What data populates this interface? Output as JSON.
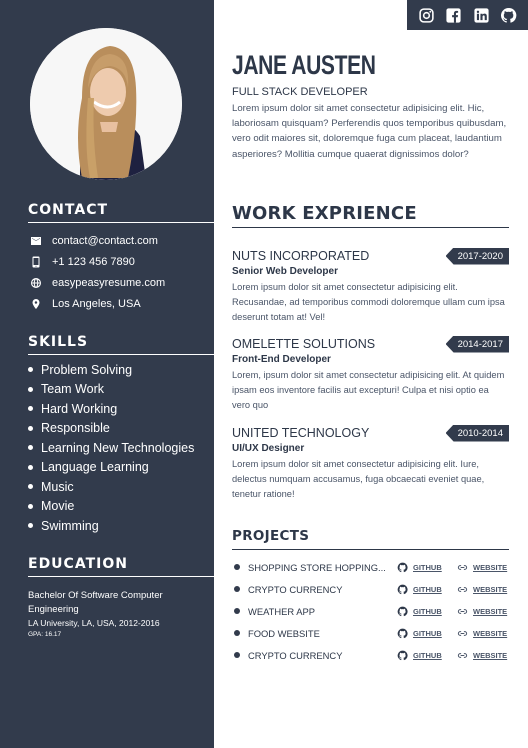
{
  "profile": {
    "name": "JANE AUSTEN",
    "role": "FULL STACK DEVELOPER",
    "bio": "Lorem ipsum dolor sit amet consectetur adipisicing elit. Hic, laboriosam quisquam? Perferendis quos temporibus quibusdam, vero odit maiores sit, doloremque fuga cum placeat, laudantium asperiores? Mollitia cumque quaerat dignissimos dolor?"
  },
  "social": [
    "instagram-icon",
    "facebook-icon",
    "linkedin-icon",
    "github-icon"
  ],
  "contact": {
    "heading": "CONTACT",
    "items": [
      {
        "icon": "mail-icon",
        "text": "contact@contact.com"
      },
      {
        "icon": "phone-icon",
        "text": "+1 123 456 7890"
      },
      {
        "icon": "globe-icon",
        "text": "easypeasyresume.com"
      },
      {
        "icon": "location-icon",
        "text": "Los Angeles, USA"
      }
    ]
  },
  "skills": {
    "heading": "SKILLS",
    "items": [
      "Problem Solving",
      "Team Work",
      "Hard Working",
      "Responsible",
      "Learning New Technologies",
      "Language Learning",
      "Music",
      "Movie",
      "Swimming"
    ]
  },
  "education": {
    "heading": "EDUCATION",
    "degree": "Bachelor Of Software Computer Engineering",
    "university": "LA University, LA, USA, 2012-2016",
    "gpa": "GPA: 16.17"
  },
  "work": {
    "heading": "WORK EXPRIENCE",
    "jobs": [
      {
        "company": "NUTS INCORPORATED",
        "years": "2017-2020",
        "title": "Senior Web Developer",
        "desc": "Lorem ipsum dolor sit amet consectetur adipisicing elit. Recusandae, ad temporibus commodi doloremque ullam cum ipsa deserunt totam at! Vel!"
      },
      {
        "company": "OMELETTE SOLUTIONS",
        "years": "2014-2017",
        "title": "Front-End Developer",
        "desc": "Lorem, ipsum dolor sit amet consectetur adipisicing elit. At quidem ipsam eos inventore facilis aut excepturi! Culpa et nisi optio ea vero quo"
      },
      {
        "company": "UNITED TECHNOLOGY",
        "years": "2010-2014",
        "title": "UI/UX Designer",
        "desc": "Lorem ipsum dolor sit amet consectetur adipisicing elit. Iure, delectus numquam accusamus, fuga obcaecati eveniet quae, tenetur ratione!"
      }
    ]
  },
  "projects": {
    "heading": "PROJECTS",
    "github_label": "GITHUB",
    "website_label": "WEBSITE",
    "items": [
      "SHOPPING STORE HOPPING...",
      "CRYPTO CURRENCY",
      "WEATHER APP",
      "FOOD WEBSITE",
      "CRYPTO CURRENCY"
    ]
  },
  "colors": {
    "sidebar": "#323b4c",
    "text": "#2d3748"
  }
}
